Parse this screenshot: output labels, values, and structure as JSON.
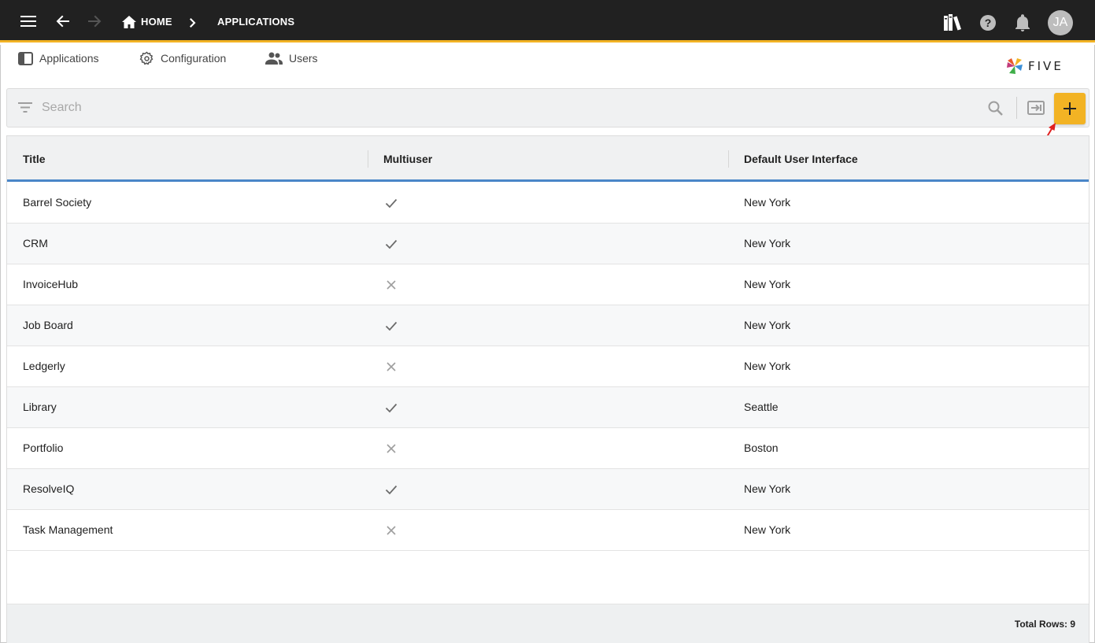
{
  "nav": {
    "home_label": "HOME",
    "current_label": "APPLICATIONS",
    "user_initials": "JA"
  },
  "tabs": [
    {
      "label": "Applications",
      "icon": "application-icon"
    },
    {
      "label": "Configuration",
      "icon": "settings-cog-icon"
    },
    {
      "label": "Users",
      "icon": "users-icon"
    }
  ],
  "logo": {
    "text": "FIVE"
  },
  "search": {
    "placeholder": "Search"
  },
  "table": {
    "columns": [
      "Title",
      "Multiuser",
      "Default User Interface"
    ],
    "rows": [
      {
        "title": "Barrel Society",
        "multiuser": true,
        "ui": "New York"
      },
      {
        "title": "CRM",
        "multiuser": true,
        "ui": "New York"
      },
      {
        "title": "InvoiceHub",
        "multiuser": false,
        "ui": "New York"
      },
      {
        "title": "Job Board",
        "multiuser": true,
        "ui": "New York"
      },
      {
        "title": "Ledgerly",
        "multiuser": false,
        "ui": "New York"
      },
      {
        "title": "Library",
        "multiuser": true,
        "ui": "Seattle"
      },
      {
        "title": "Portfolio",
        "multiuser": false,
        "ui": "Boston"
      },
      {
        "title": "ResolveIQ",
        "multiuser": true,
        "ui": "New York"
      },
      {
        "title": "Task Management",
        "multiuser": false,
        "ui": "New York"
      }
    ],
    "total_label": "Total Rows: 9"
  },
  "colors": {
    "appbar": "#212121",
    "accent": "#f2b324",
    "header_underline": "#4a86c8",
    "annotation": "#e02020"
  }
}
